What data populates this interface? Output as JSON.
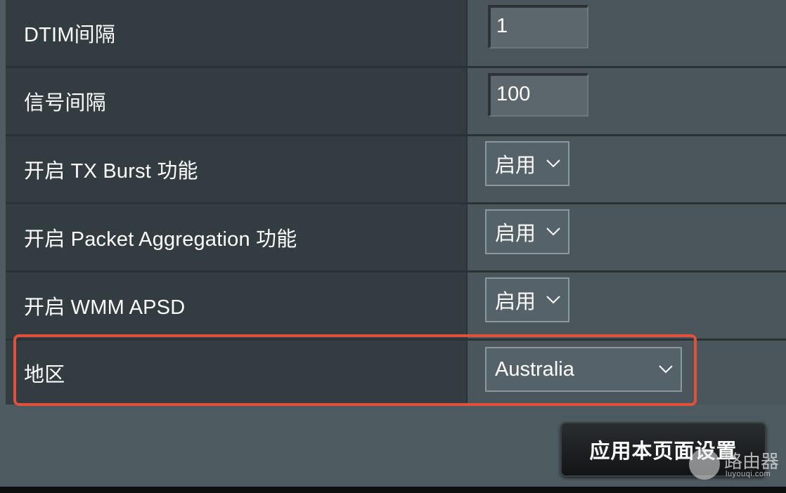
{
  "rows": [
    {
      "label": "DTIM间隔",
      "value": "1"
    },
    {
      "label": "信号间隔",
      "value": "100"
    },
    {
      "label": "开启 TX Burst 功能",
      "value": "启用"
    },
    {
      "label": "开启 Packet Aggregation 功能",
      "value": "启用"
    },
    {
      "label": "开启 WMM APSD",
      "value": "启用"
    },
    {
      "label": "地区",
      "value": "Australia"
    }
  ],
  "apply_button": "应用本页面设置",
  "watermark": {
    "text": "路由器",
    "sub": "luyouqi.com"
  },
  "colors": {
    "highlight": "#e0503a",
    "label_bg": "#323c41",
    "value_bg": "#4a565c"
  }
}
